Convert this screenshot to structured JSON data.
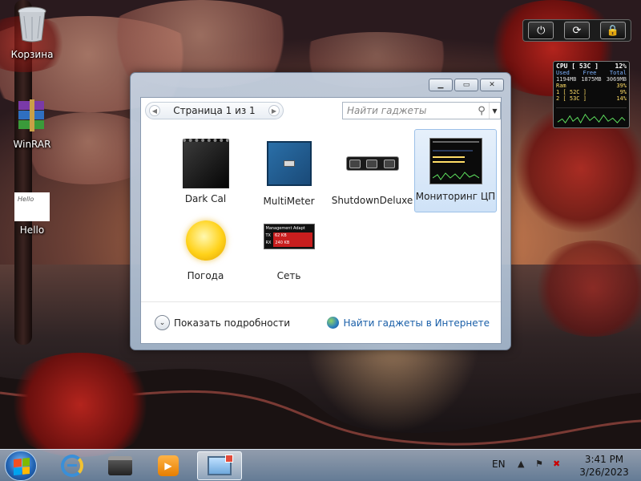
{
  "desktop": {
    "icons": [
      {
        "label": "Корзина"
      },
      {
        "label": "WinRAR"
      },
      {
        "label": "Hello",
        "thumb_text": "Hello"
      }
    ]
  },
  "sidebar_controls": {
    "buttons": [
      {
        "icon": "power-icon"
      },
      {
        "icon": "refresh-icon"
      },
      {
        "icon": "lock-icon"
      }
    ]
  },
  "cpu_gadget": {
    "title": "CPU [ 53C ]",
    "percent": "12%",
    "headers": [
      "Used",
      "Free",
      "Total"
    ],
    "values": [
      "1194MB",
      "1875MB",
      "3069MB"
    ],
    "rows": [
      {
        "label": "Ram",
        "value": "39%"
      },
      {
        "label": "1 [ 52C ]",
        "value": "9%"
      },
      {
        "label": "2 [ 53C ]",
        "value": "14%"
      }
    ],
    "ram_fraction": 0.39,
    "core1_fraction": 0.09,
    "core2_fraction": 0.14
  },
  "gadget_window": {
    "pager_label": "Страница 1 из 1",
    "search_placeholder": "Найти гаджеты",
    "gadgets": [
      {
        "name": "Dark Cal",
        "selected": false
      },
      {
        "name": "MultiMeter",
        "selected": false
      },
      {
        "name": "ShutdownDeluxe",
        "selected": false
      },
      {
        "name": "Мониторинг ЦП",
        "selected": true
      },
      {
        "name": "Погода",
        "selected": false
      },
      {
        "name": "Сеть",
        "selected": false
      }
    ],
    "net_thumb": {
      "title": "Management Adapt",
      "tx": "62 KB",
      "rx": "240 KB",
      "tx_label": "TX",
      "rx_label": "RX"
    },
    "show_details_label": "Показать подробности",
    "online_label": "Найти гаджеты в Интернете"
  },
  "taskbar": {
    "language": "EN",
    "time": "3:41 PM",
    "date": "3/26/2023"
  }
}
